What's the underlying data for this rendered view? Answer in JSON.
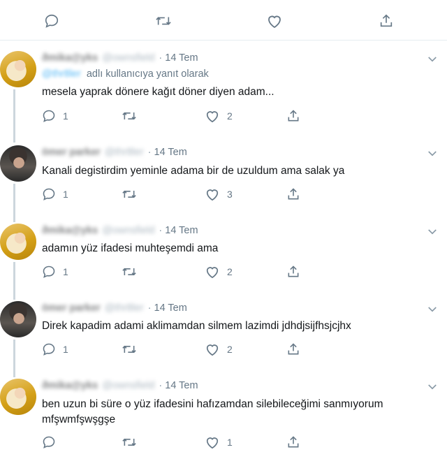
{
  "top_actions": [
    "reply",
    "retweet",
    "like",
    "share"
  ],
  "tweets": [
    {
      "avatar": "blonde",
      "name": "ðmika@yks",
      "handle": "@ownsfield",
      "time": "14 Tem",
      "reply_to": "@thr8ler",
      "reply_label": "adlı kullanıcıya yanıt olarak",
      "text": "mesela yaprak dönere kağıt döner diyen adam...",
      "reply_count": "1",
      "retweet_count": "",
      "like_count": "2"
    },
    {
      "avatar": "dark",
      "name": "ömer parker",
      "handle": "@thr8ler",
      "time": "14 Tem",
      "text": "Kanali degistirdim yeminle adama bir de uzuldum ama salak ya",
      "reply_count": "1",
      "retweet_count": "",
      "like_count": "3"
    },
    {
      "avatar": "blonde",
      "name": "ðmika@yks",
      "handle": "@ownsfield",
      "time": "14 Tem",
      "text": "adamın yüz ifadesi muhteşemdi ama",
      "reply_count": "1",
      "retweet_count": "",
      "like_count": "2"
    },
    {
      "avatar": "dark",
      "name": "ömer parker",
      "handle": "@thr8ler",
      "time": "14 Tem",
      "text": "Direk kapadim adami aklimamdan silmem lazimdi jdhdjsijfhsjcjhx",
      "reply_count": "1",
      "retweet_count": "",
      "like_count": "2"
    },
    {
      "avatar": "blonde",
      "name": "ðmika@yks",
      "handle": "@ownsfield",
      "time": "14 Tem",
      "text": "ben uzun bi süre o yüz ifadesini hafızamdan silebileceğimi sanmıyorum mfşwmfşwşgşe",
      "reply_count": "",
      "retweet_count": "",
      "like_count": "1"
    }
  ],
  "separator": "·",
  "colors": {
    "icon": "#657786",
    "thread_line": "#ccd6dd",
    "mention": "#1da1f2",
    "divider": "#e6ecf0"
  }
}
